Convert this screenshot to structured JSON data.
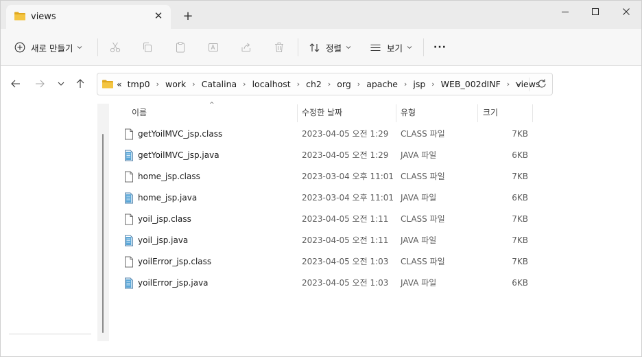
{
  "window": {
    "tab_title": "views",
    "new_tab_symbol": "+",
    "close_tab_symbol": "✕"
  },
  "toolbar": {
    "new_label": "새로 만들기",
    "sort_label": "정렬",
    "view_label": "보기",
    "more_label": "···"
  },
  "address": {
    "overflow": "«",
    "crumbs": [
      "tmp0",
      "work",
      "Catalina",
      "localhost",
      "ch2",
      "org",
      "apache",
      "jsp",
      "WEB_002dINF",
      "views"
    ]
  },
  "columns": {
    "name": "이름",
    "date": "수정한 날짜",
    "type": "유형",
    "size": "크기"
  },
  "files": [
    {
      "name": "getYoilMVC_jsp.class",
      "date": "2023-04-05 오전 1:29",
      "type": "CLASS 파일",
      "size": "7KB",
      "icon": "file-icon"
    },
    {
      "name": "getYoilMVC_jsp.java",
      "date": "2023-04-05 오전 1:29",
      "type": "JAVA 파일",
      "size": "6KB",
      "icon": "java-file-icon"
    },
    {
      "name": "home_jsp.class",
      "date": "2023-03-04 오후 11:01",
      "type": "CLASS 파일",
      "size": "7KB",
      "icon": "file-icon"
    },
    {
      "name": "home_jsp.java",
      "date": "2023-03-04 오후 11:01",
      "type": "JAVA 파일",
      "size": "6KB",
      "icon": "java-file-icon"
    },
    {
      "name": "yoil_jsp.class",
      "date": "2023-04-05 오전 1:11",
      "type": "CLASS 파일",
      "size": "7KB",
      "icon": "file-icon"
    },
    {
      "name": "yoil_jsp.java",
      "date": "2023-04-05 오전 1:11",
      "type": "JAVA 파일",
      "size": "7KB",
      "icon": "java-file-icon"
    },
    {
      "name": "yoilError_jsp.class",
      "date": "2023-04-05 오전 1:03",
      "type": "CLASS 파일",
      "size": "7KB",
      "icon": "file-icon"
    },
    {
      "name": "yoilError_jsp.java",
      "date": "2023-04-05 오전 1:03",
      "type": "JAVA 파일",
      "size": "6KB",
      "icon": "java-file-icon"
    }
  ],
  "colors": {
    "folder": "#f4c542",
    "folder_dark": "#e0a81e",
    "java_icon": "#5ba7d8",
    "chrome_bg": "#ebebeb",
    "toolbar_bg": "#f7f7f7"
  }
}
